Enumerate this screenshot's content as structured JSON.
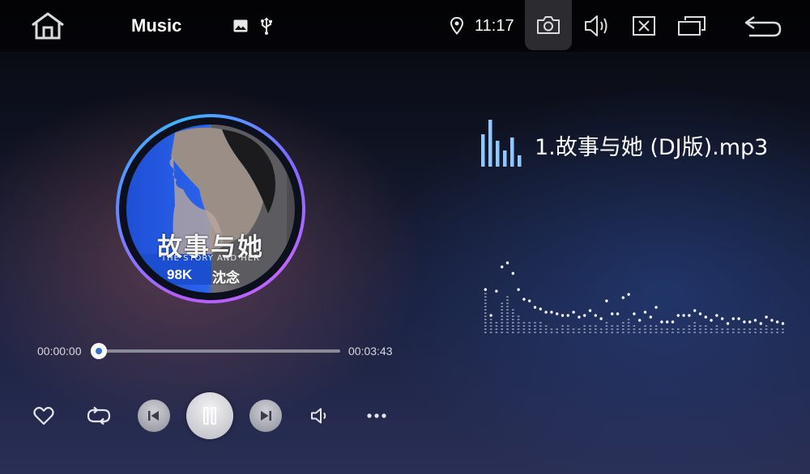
{
  "status_bar": {
    "app_title": "Music",
    "clock": "11:17",
    "icons": [
      "home-icon",
      "gallery-icon",
      "usb-icon",
      "location-icon",
      "camera-icon",
      "volume-icon",
      "close-app-icon",
      "recent-apps-icon",
      "back-icon"
    ]
  },
  "player": {
    "track_title": "1.故事与她 (DJ版).mp3",
    "current_time": "00:00:00",
    "total_time": "00:03:43",
    "progress": 0.0,
    "state": "playing"
  },
  "album_cover": {
    "title": "故事与她",
    "subtitle": "THE STORY AND HER",
    "label_left": "98K",
    "label_right": "沈念"
  },
  "controls": [
    "favorite",
    "repeat",
    "previous",
    "pause",
    "next",
    "sound-effect",
    "more"
  ],
  "colors": {
    "accent": "#3a6fd0",
    "ring_start": "#b55cff",
    "ring_end": "#3fb3ff",
    "track_icon": "#8fc8ff"
  }
}
